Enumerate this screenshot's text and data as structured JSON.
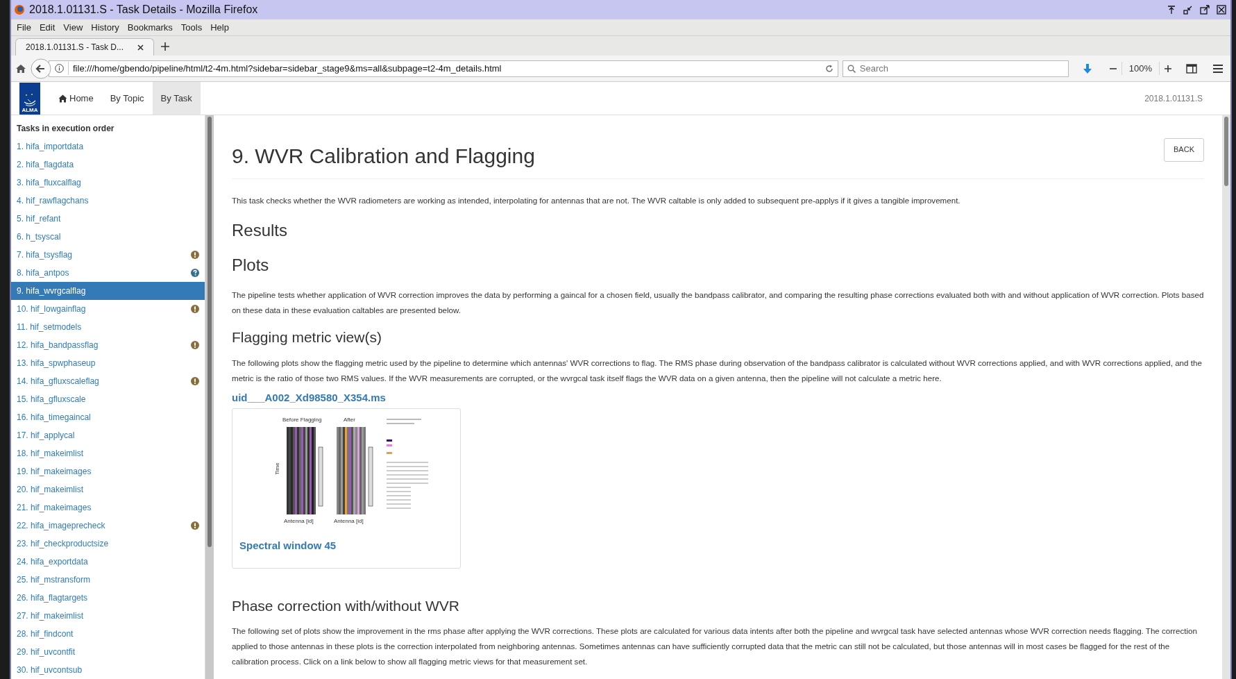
{
  "window": {
    "title": "2018.1.01131.S - Task Details - Mozilla Firefox"
  },
  "menu": [
    {
      "label": "File"
    },
    {
      "label": "Edit"
    },
    {
      "label": "View"
    },
    {
      "label": "History"
    },
    {
      "label": "Bookmarks"
    },
    {
      "label": "Tools"
    },
    {
      "label": "Help"
    }
  ],
  "tabs": [
    {
      "label": "2018.1.01131.S - Task D...",
      "selected": true
    }
  ],
  "address_bar": {
    "url": "file:///home/gbendo/pipeline/html/t2-4m.html?sidebar=sidebar_stage9&ms=all&subpage=t2-4m_details.html"
  },
  "search": {
    "placeholder": "Search"
  },
  "zoom": "100%",
  "header": {
    "logo": "ALMA",
    "nav": [
      {
        "label": "Home",
        "selected": false,
        "kind": "home"
      },
      {
        "label": "By Topic",
        "selected": false
      },
      {
        "label": "By Task",
        "selected": true
      }
    ],
    "project": "2018.1.01131.S"
  },
  "sidebar": {
    "heading": "Tasks in execution order",
    "items": [
      {
        "label": "1. hifa_importdata",
        "selected": false,
        "kind": "plain"
      },
      {
        "label": "2. hifa_flagdata",
        "selected": false,
        "kind": "plain"
      },
      {
        "label": "3. hifa_fluxcalflag",
        "selected": false,
        "kind": "plain"
      },
      {
        "label": "4. hif_rawflagchans",
        "selected": false,
        "kind": "plain"
      },
      {
        "label": "5. hif_refant",
        "selected": false,
        "kind": "plain"
      },
      {
        "label": "6. h_tsyscal",
        "selected": false,
        "kind": "plain"
      },
      {
        "label": "7. hifa_tsysflag",
        "selected": false,
        "kind": "warning"
      },
      {
        "label": "8. hifa_antpos",
        "selected": false,
        "kind": "info"
      },
      {
        "label": "9. hifa_wvrgcalflag",
        "selected": true,
        "kind": "plain"
      },
      {
        "label": "10. hif_lowgainflag",
        "selected": false,
        "kind": "warning"
      },
      {
        "label": "11. hif_setmodels",
        "selected": false,
        "kind": "plain"
      },
      {
        "label": "12. hifa_bandpassflag",
        "selected": false,
        "kind": "warning"
      },
      {
        "label": "13. hifa_spwphaseup",
        "selected": false,
        "kind": "plain"
      },
      {
        "label": "14. hifa_gfluxscaleflag",
        "selected": false,
        "kind": "warning"
      },
      {
        "label": "15. hifa_gfluxscale",
        "selected": false,
        "kind": "plain"
      },
      {
        "label": "16. hifa_timegaincal",
        "selected": false,
        "kind": "plain"
      },
      {
        "label": "17. hif_applycal",
        "selected": false,
        "kind": "plain"
      },
      {
        "label": "18. hif_makeimlist",
        "selected": false,
        "kind": "plain"
      },
      {
        "label": "19. hif_makeimages",
        "selected": false,
        "kind": "plain"
      },
      {
        "label": "20. hif_makeimlist",
        "selected": false,
        "kind": "plain"
      },
      {
        "label": "21. hif_makeimages",
        "selected": false,
        "kind": "plain"
      },
      {
        "label": "22. hifa_imageprecheck",
        "selected": false,
        "kind": "warning"
      },
      {
        "label": "23. hif_checkproductsize",
        "selected": false,
        "kind": "plain"
      },
      {
        "label": "24. hifa_exportdata",
        "selected": false,
        "kind": "plain"
      },
      {
        "label": "25. hif_mstransform",
        "selected": false,
        "kind": "plain"
      },
      {
        "label": "26. hifa_flagtargets",
        "selected": false,
        "kind": "plain"
      },
      {
        "label": "27. hif_makeimlist",
        "selected": false,
        "kind": "plain"
      },
      {
        "label": "28. hif_findcont",
        "selected": false,
        "kind": "plain"
      },
      {
        "label": "29. hif_uvcontfit",
        "selected": false,
        "kind": "plain"
      },
      {
        "label": "30. hif_uvcontsub",
        "selected": false,
        "kind": "plain"
      }
    ]
  },
  "content": {
    "title": "9. WVR Calibration and Flagging",
    "back_button": "BACK",
    "blocks": [
      {
        "kind": "p",
        "text": "This task checks whether the WVR radiometers are working as intended, interpolating for antennas that are not. The WVR caltable is only added to subsequent pre-applys if it gives a tangible improvement."
      },
      {
        "kind": "h2",
        "text": "Results"
      },
      {
        "kind": "h2",
        "text": "Plots"
      },
      {
        "kind": "p",
        "text": "The pipeline tests whether application of WVR correction improves the data by performing a gaincal for a chosen field, usually the bandpass calibrator, and comparing the resulting phase corrections evaluated both with and without application of WVR correction. Plots based on these data in these evaluation caltables are presented below."
      },
      {
        "kind": "h3",
        "text": "Flagging metric view(s)"
      },
      {
        "kind": "p",
        "text": "The following plots show the flagging metric used by the pipeline to determine which antennas' WVR corrections to flag. The RMS phase during observation of the bandpass calibrator is calculated without WVR corrections applied, and with WVR corrections applied, and the metric is the ratio of those two RMS values. If the WVR measurements are corrupted, or the wvrgcal task itself flags the WVR data on a given antenna, then the pipeline will not calculate a metric here."
      },
      {
        "kind": "link",
        "text": "uid___A002_Xd98580_X354.ms"
      },
      {
        "kind": "figure",
        "caption": "Spectral window 45",
        "before": "Before Flagging",
        "after": "After",
        "ylabel": "Time",
        "xlabel_left": "Antenna [id]",
        "xlabel_right": "Antenna [id]"
      },
      {
        "kind": "h3",
        "text": "Phase correction with/without WVR"
      },
      {
        "kind": "p",
        "text": "The following set of plots show the improvement in the rms phase after applying the WVR corrections. These plots are calculated for various data intents after both the pipeline and wvrgcal task have selected antennas whose WVR correction needs flagging. The correction applied to those antennas in these plots is the correction interpolated from neighboring antennas. Sometimes antennas can have sufficiently corrupted data that the metric can still not be calculated, but those antennas will in most cases be flagged for the rest of the calibration process. Click on a link below to show all flagging metric views for that measurement set."
      }
    ]
  }
}
